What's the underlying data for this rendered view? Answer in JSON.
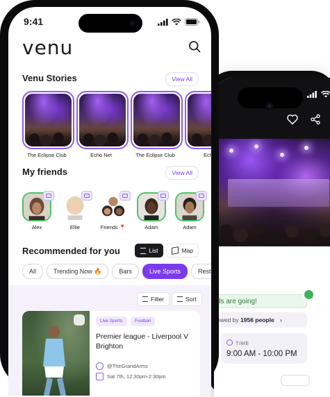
{
  "back_phone": {
    "going_text": "ds are going!",
    "viewed_prefix": "ewed by ",
    "viewed_count": "1956 people",
    "viewed_chevron": "›",
    "time_label": "TIME",
    "time_value": "9:00 AM - 10:00 PM",
    "icons": [
      "heart-icon",
      "share-icon"
    ]
  },
  "status_bar": {
    "time": "9:41"
  },
  "app": {
    "logo": "venu"
  },
  "stories": {
    "title": "Venu Stories",
    "view_all": "View All",
    "items": [
      {
        "name": "The Eclipse Club"
      },
      {
        "name": "Echo Net"
      },
      {
        "name": "The Eclipse Club"
      },
      {
        "name": "Echo"
      }
    ]
  },
  "friends": {
    "title": "My friends",
    "view_all": "View All",
    "items": [
      {
        "name": "Alex"
      },
      {
        "name": "Ellie"
      },
      {
        "name": "Friends 📍"
      },
      {
        "name": "Adam"
      },
      {
        "name": "Adam"
      }
    ]
  },
  "recommended": {
    "title": "Recommended for you",
    "view_toggle": {
      "list": "List",
      "map": "Map",
      "selected": "list"
    },
    "chips": [
      {
        "label": "All",
        "active": false
      },
      {
        "label": "Trending Now 🔥",
        "active": false
      },
      {
        "label": "Bars",
        "active": false
      },
      {
        "label": "Live Sports",
        "active": true
      },
      {
        "label": "Restau",
        "active": false
      }
    ],
    "filter": "Filter",
    "sort": "Sort",
    "card": {
      "tags": [
        "Live Sports",
        "Football"
      ],
      "title": "Premier league - Liverpool V Brighton",
      "venue": "@TheGrandArms",
      "datetime": "Sat 7th, 12:30pm-2:30pm"
    }
  },
  "colors": {
    "accent": "#7c3aed",
    "friend_ring": "#4cc266",
    "panel_bg": "#f4f1fb"
  }
}
